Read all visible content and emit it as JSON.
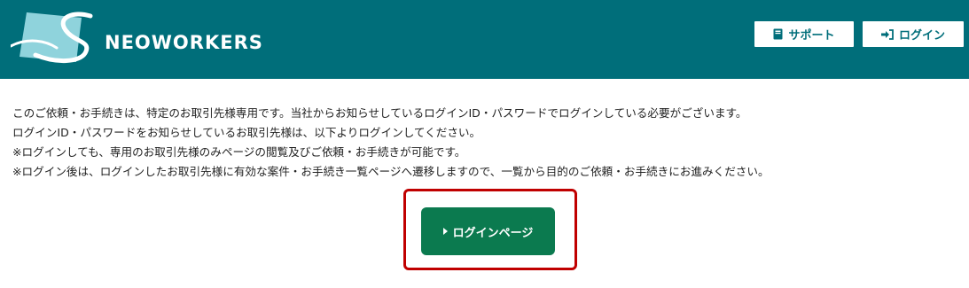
{
  "header": {
    "brand": "NEOWORKERS",
    "background": "#006e7a",
    "buttons": {
      "support": {
        "label": "サポート",
        "icon": "book-icon"
      },
      "login": {
        "label": "ログイン",
        "icon": "sign-in-icon"
      }
    }
  },
  "message": {
    "lines": [
      "このご依頼・お手続きは、特定のお取引先様専用です。当社からお知らせしているログインID・パスワードでログインしている必要がございます。",
      "ログインID・パスワードをお知らせしているお取引先様は、以下よりログインしてください。",
      "※ログインしても、専用のお取引先様のみページの閲覧及びご依頼・お手続きが可能です。",
      "※ログイン後は、ログインしたお取引先様に有効な案件・お手続き一覧ページへ遷移しますので、一覧から目的のご依頼・お手続きにお進みください。"
    ]
  },
  "cta": {
    "label": "ログインページ",
    "color": "#0b7a4f",
    "highlight_color": "#c00000"
  }
}
